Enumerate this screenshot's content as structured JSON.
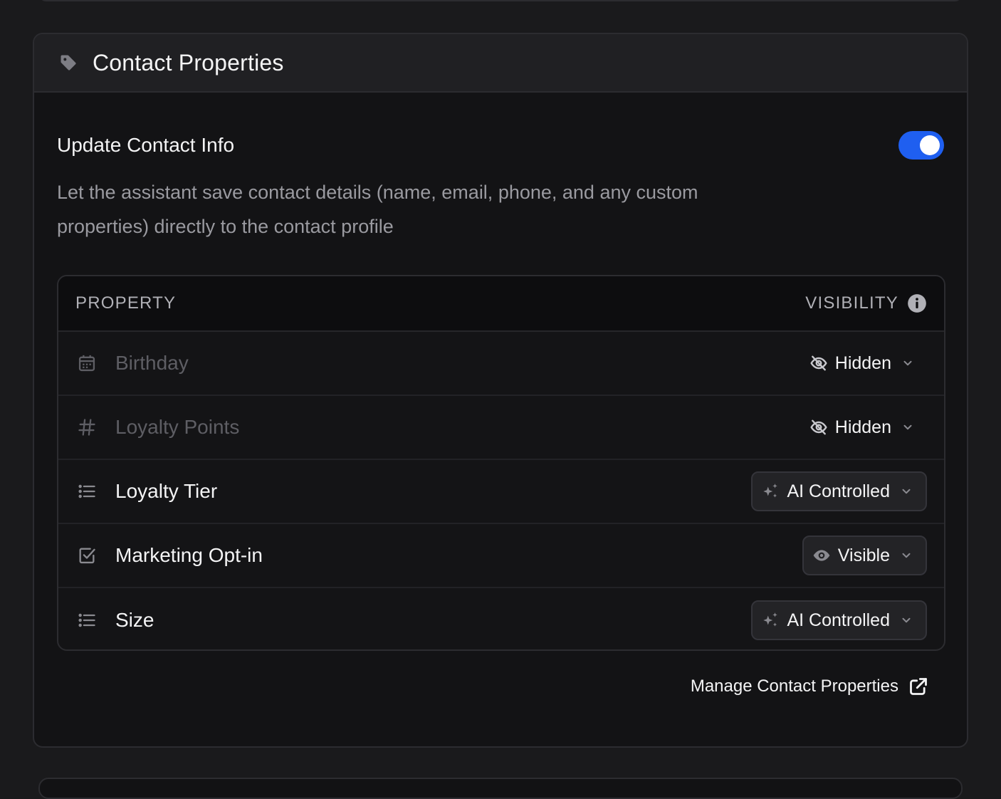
{
  "card": {
    "title": "Contact Properties",
    "icon": "tag-icon"
  },
  "setting": {
    "title": "Update Contact Info",
    "enabled": true,
    "description": "Let the assistant save contact details (name, email, phone, and any custom properties) directly to the contact profile",
    "accent_color": "#1f5ff0"
  },
  "table": {
    "headers": {
      "property": "PROPERTY",
      "visibility": "VISIBILITY"
    },
    "rows": [
      {
        "name": "Birthday",
        "icon": "calendar-icon",
        "visibility": "Hidden",
        "visibility_icon": "eye-off-icon",
        "dimmed": true
      },
      {
        "name": "Loyalty Points",
        "icon": "hash-icon",
        "visibility": "Hidden",
        "visibility_icon": "eye-off-icon",
        "dimmed": true
      },
      {
        "name": "Loyalty Tier",
        "icon": "list-icon",
        "visibility": "AI Controlled",
        "visibility_icon": "sparkles-icon",
        "dimmed": false
      },
      {
        "name": "Marketing Opt-in",
        "icon": "checkbox-icon",
        "visibility": "Visible",
        "visibility_icon": "eye-icon",
        "dimmed": false
      },
      {
        "name": "Size",
        "icon": "list-icon",
        "visibility": "AI Controlled",
        "visibility_icon": "sparkles-icon",
        "dimmed": false
      }
    ]
  },
  "footer": {
    "manage_link": "Manage Contact Properties",
    "link_icon": "external-link-icon"
  }
}
